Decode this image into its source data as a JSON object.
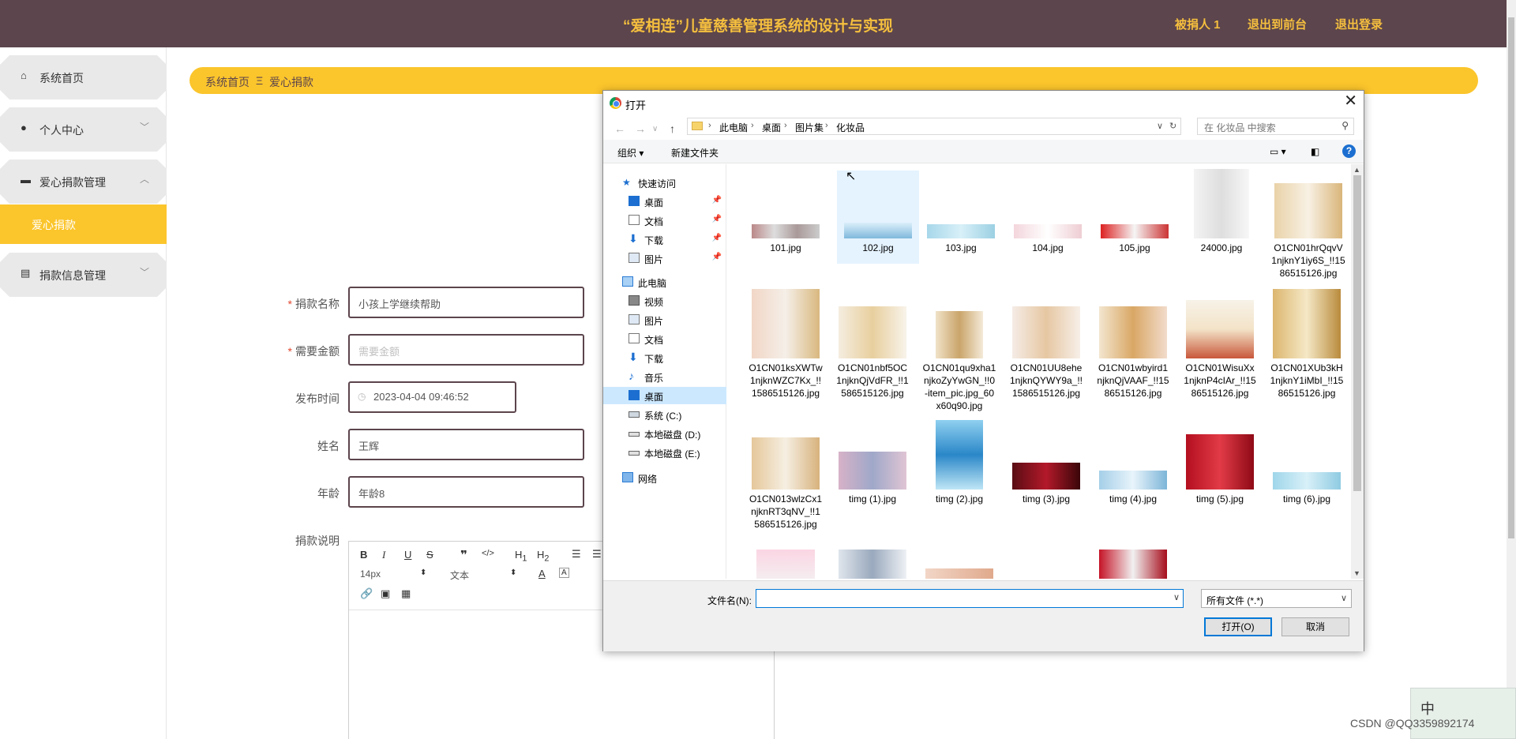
{
  "header": {
    "title": "“爱相连”儿童慈善管理系统的设计与实现",
    "nav": [
      "被捐人 1",
      "退出到前台",
      "退出登录"
    ]
  },
  "sidebar": {
    "items": [
      {
        "label": "系统首页",
        "icon": "home-icon"
      },
      {
        "label": "个人中心",
        "icon": "user-icon"
      },
      {
        "label": "爱心捐款管理",
        "icon": "briefcase-icon"
      },
      {
        "label": "爱心捐款",
        "icon": ""
      },
      {
        "label": "捐款信息管理",
        "icon": "document-icon"
      }
    ]
  },
  "breadcrumb": {
    "home": "系统首页",
    "sep": "Ξ",
    "current": "爱心捐款"
  },
  "form": {
    "fields": [
      {
        "label": "捐款名称",
        "required": true,
        "value": "小孩上学继续帮助"
      },
      {
        "label": "需要金额",
        "required": true,
        "placeholder": "需要金额"
      },
      {
        "label": "发布时间",
        "required": false,
        "value": "2023-04-04 09:46:52"
      },
      {
        "label": "姓名",
        "required": false,
        "value": "王辉"
      },
      {
        "label": "年龄",
        "required": false,
        "value": "年龄8"
      },
      {
        "label": "捐款说明",
        "required": false
      }
    ],
    "editor": {
      "font_size": "14px",
      "block_type": "文本"
    }
  },
  "dialog": {
    "title": "打开",
    "breadcrumb": [
      "此电脑",
      "桌面",
      "图片集",
      "化妆品"
    ],
    "search_placeholder": "在 化妆品 中搜索",
    "toolbar": {
      "organize": "组织 ▾",
      "new_folder": "新建文件夹"
    },
    "nav_items": [
      {
        "label": "快速访问",
        "pinned": false,
        "selected": false
      },
      {
        "label": "桌面",
        "pinned": true,
        "selected": false
      },
      {
        "label": "文档",
        "pinned": true,
        "selected": false
      },
      {
        "label": "下载",
        "pinned": true,
        "selected": false
      },
      {
        "label": "图片",
        "pinned": true,
        "selected": false
      },
      {
        "label": "此电脑",
        "pinned": false,
        "selected": false
      },
      {
        "label": "视频",
        "pinned": false,
        "selected": false
      },
      {
        "label": "图片",
        "pinned": false,
        "selected": false
      },
      {
        "label": "文档",
        "pinned": false,
        "selected": false
      },
      {
        "label": "下载",
        "pinned": false,
        "selected": false
      },
      {
        "label": "音乐",
        "pinned": false,
        "selected": false
      },
      {
        "label": "桌面",
        "pinned": false,
        "selected": true
      },
      {
        "label": "系统 (C:)",
        "pinned": false,
        "selected": false
      },
      {
        "label": "本地磁盘 (D:)",
        "pinned": false,
        "selected": false
      },
      {
        "label": "本地磁盘 (E:)",
        "pinned": false,
        "selected": false
      },
      {
        "label": "网络",
        "pinned": false,
        "selected": false
      }
    ],
    "files": [
      "101.jpg",
      "102.jpg",
      "103.jpg",
      "104.jpg",
      "105.jpg",
      "24000.jpg",
      "O1CN01hrQqvV1njknY1iy6S_!!1586515126.jpg",
      "O1CN01ksXWTw1njknWZC7Kx_!!1586515126.jpg",
      "O1CN01nbf5OC1njknQjVdFR_!!1586515126.jpg",
      "O1CN01qu9xha1njkoZyYwGN_!!0-item_pic.jpg_60x60q90.jpg",
      "O1CN01UU8ehe1njknQYWY9a_!!1586515126.jpg",
      "O1CN01wbyird1njknQjVAAF_!!1586515126.jpg",
      "O1CN01WisuXx1njknP4cIAr_!!1586515126.jpg",
      "O1CN01XUb3kH1njknY1iMbI_!!1586515126.jpg",
      "O1CN013wlzCx1njknRT3qNV_!!1586515126.jpg",
      "timg (1).jpg",
      "timg (2).jpg",
      "timg (3).jpg",
      "timg (4).jpg",
      "timg (5).jpg",
      "timg (6).jpg"
    ],
    "filename_label": "文件名(N):",
    "filename_value": "",
    "filetype": "所有文件 (*.*)",
    "open_button": "打开(O)",
    "cancel_button": "取消"
  },
  "ime": {
    "label": "中"
  },
  "watermark": "CSDN @QQ3359892174",
  "colors": {
    "header": "#5c454c",
    "accent": "#fbc52c",
    "header_text": "#f5bf3e"
  }
}
